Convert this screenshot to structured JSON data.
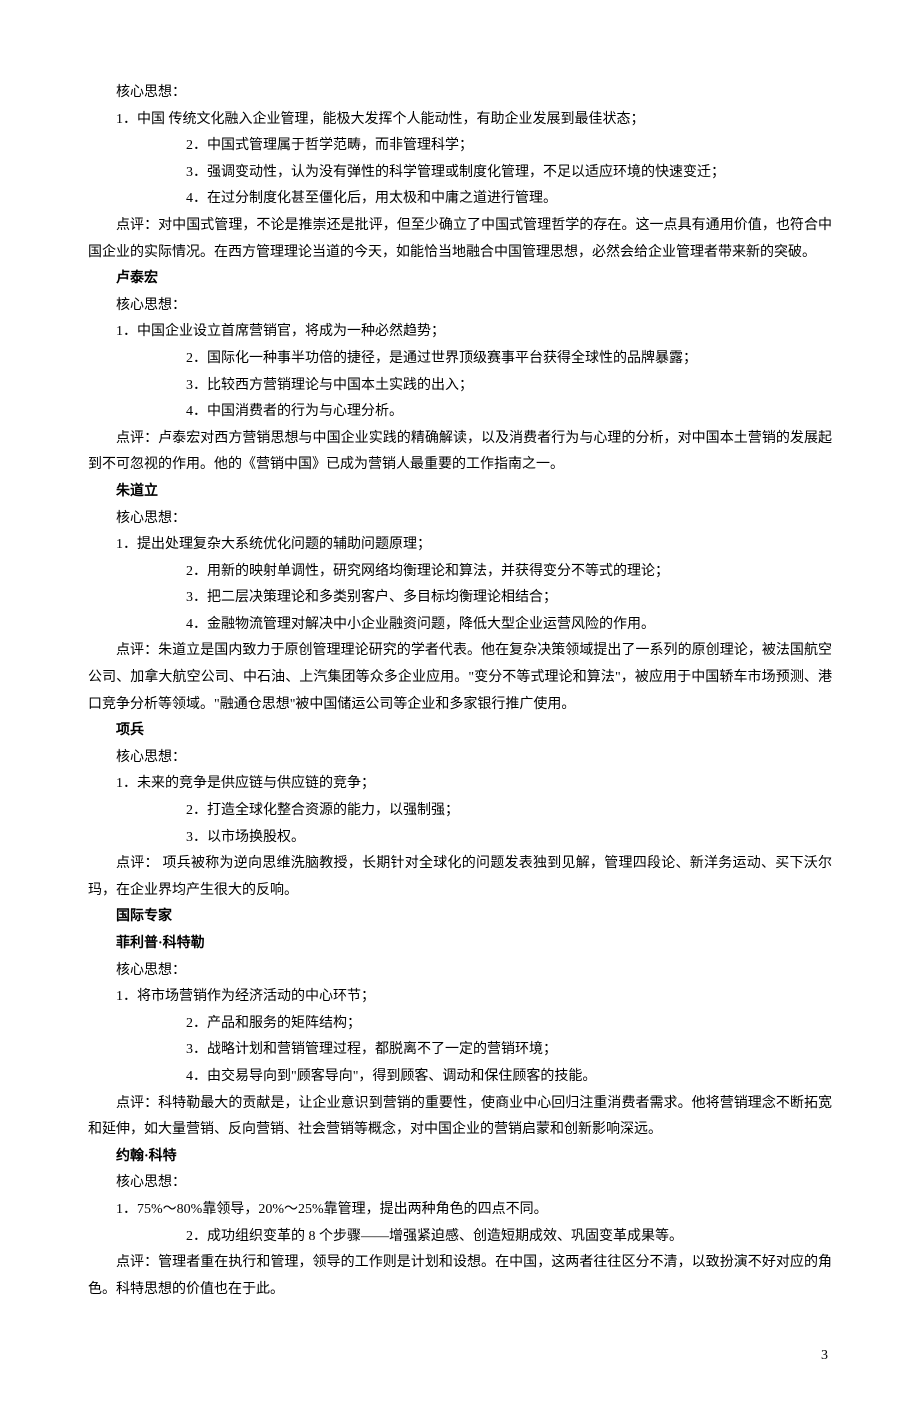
{
  "s1": {
    "head": "核心思想：",
    "i1": "1．中国 传统文化融入企业管理，能极大发挥个人能动性，有助企业发展到最佳状态；",
    "i2": "2．中国式管理属于哲学范畴，而非管理科学；",
    "i3": "3．强调变动性，认为没有弹性的科学管理或制度化管理，不足以适应环境的快速变迁；",
    "i4": "4．在过分制度化甚至僵化后，用太极和中庸之道进行管理。",
    "comment": "点评：对中国式管理，不论是推崇还是批评，但至少确立了中国式管理哲学的存在。这一点具有通用价值，也符合中国企业的实际情况。在西方管理理论当道的今天，如能恰当地融合中国管理思想，必然会给企业管理者带来新的突破。"
  },
  "s2": {
    "name": "卢泰宏",
    "head": "核心思想：",
    "i1": "1．中国企业设立首席营销官，将成为一种必然趋势；",
    "i2": "2．国际化一种事半功倍的捷径，是通过世界顶级赛事平台获得全球性的品牌暴露；",
    "i3": "3．比较西方营销理论与中国本土实践的出入；",
    "i4": "4．中国消费者的行为与心理分析。",
    "comment": "点评：卢泰宏对西方营销思想与中国企业实践的精确解读，以及消费者行为与心理的分析，对中国本土营销的发展起到不可忽视的作用。他的《营销中国》已成为营销人最重要的工作指南之一。"
  },
  "s3": {
    "name": "朱道立",
    "head": "核心思想：",
    "i1": "1．提出处理复杂大系统优化问题的辅助问题原理；",
    "i2": "2．用新的映射单调性，研究网络均衡理论和算法，并获得变分不等式的理论；",
    "i3": "3．把二层决策理论和多类别客户、多目标均衡理论相结合；",
    "i4": "4．金融物流管理对解决中小企业融资问题，降低大型企业运营风险的作用。",
    "comment": "点评：朱道立是国内致力于原创管理理论研究的学者代表。他在复杂决策领域提出了一系列的原创理论，被法国航空公司、加拿大航空公司、中石油、上汽集团等众多企业应用。\"变分不等式理论和算法\"，被应用于中国轿车市场预测、港口竞争分析等领域。\"融通仓思想\"被中国储运公司等企业和多家银行推广使用。"
  },
  "s4": {
    "name": "项兵",
    "head": "核心思想：",
    "i1": "1．未来的竞争是供应链与供应链的竞争；",
    "i2": "2．打造全球化整合资源的能力，以强制强；",
    "i3": "3．以市场换股权。",
    "comment": "点评： 项兵被称为逆向思维洗脑教授，长期针对全球化的问题发表独到见解，管理四段论、新洋务运动、买下沃尔玛，在企业界均产生很大的反响。"
  },
  "intlHeader": "国际专家",
  "s5": {
    "name": "菲利普·科特勒",
    "head": "核心思想：",
    "i1": "1．将市场营销作为经济活动的中心环节；",
    "i2": "2．产品和服务的矩阵结构；",
    "i3": "3．战略计划和营销管理过程，都脱离不了一定的营销环境；",
    "i4": "4．由交易导向到\"顾客导向\"，得到顾客、调动和保住顾客的技能。",
    "comment": "点评：科特勒最大的贡献是，让企业意识到营销的重要性，使商业中心回归注重消费者需求。他将营销理念不断拓宽和延伸，如大量营销、反向营销、社会营销等概念，对中国企业的营销启蒙和创新影响深远。"
  },
  "s6": {
    "name": "约翰·科特",
    "head": "核心思想：",
    "i1": "1．75%～80%靠领导，20%～25%靠管理，提出两种角色的四点不同。",
    "i2": "2．成功组织变革的 8 个步骤——增强紧迫感、创造短期成效、巩固变革成果等。",
    "comment": "点评：管理者重在执行和管理，领导的工作则是计划和设想。在中国，这两者往往区分不清，以致扮演不好对应的角色。科特思想的价值也在于此。"
  },
  "pageNum": "3"
}
